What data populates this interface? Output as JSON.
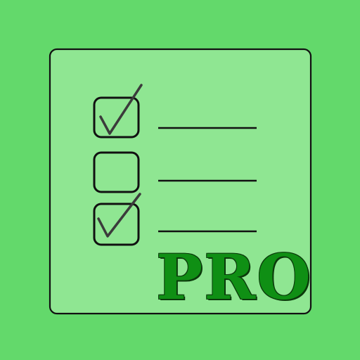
{
  "app_icon": {
    "badge_text": "PRO",
    "colors": {
      "background": "#63d96b",
      "card": "#8fe692",
      "outline": "#111111",
      "check": "#3b3b3b",
      "badge": "#0f8f14"
    },
    "checklist": [
      {
        "checked": true
      },
      {
        "checked": false
      },
      {
        "checked": true
      }
    ]
  }
}
